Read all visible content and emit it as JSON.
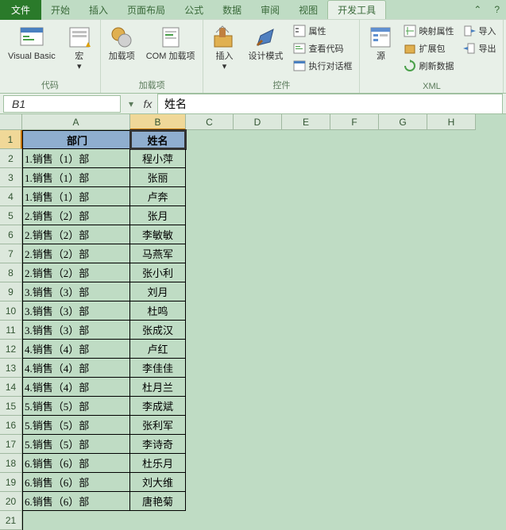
{
  "tabs": {
    "file": "文件",
    "home": "开始",
    "insert": "插入",
    "layout": "页面布局",
    "formulas": "公式",
    "data": "数据",
    "review": "审阅",
    "view": "视图",
    "developer": "开发工具"
  },
  "ribbon": {
    "vb": "Visual Basic",
    "macro": "宏",
    "group_code": "代码",
    "addins": "加载项",
    "comaddins": "COM 加载项",
    "group_addins": "加载项",
    "insert": "插入",
    "design": "设计模式",
    "properties": "属性",
    "viewcode": "查看代码",
    "rundialog": "执行对话框",
    "group_controls": "控件",
    "source": "源",
    "mapprops": "映射属性",
    "expansion": "扩展包",
    "refresh": "刷新数据",
    "import": "导入",
    "export": "导出",
    "group_xml": "XML"
  },
  "namebox": "B1",
  "formula": "姓名",
  "colheads": [
    "A",
    "B",
    "C",
    "D",
    "E",
    "F",
    "G",
    "H"
  ],
  "header": {
    "dept": "部门",
    "name": "姓名"
  },
  "rows": [
    {
      "a": "1.销售（1）部",
      "b": "程小萍"
    },
    {
      "a": "1.销售（1）部",
      "b": "张丽"
    },
    {
      "a": "1.销售（1）部",
      "b": "卢奔"
    },
    {
      "a": "2.销售（2）部",
      "b": "张月"
    },
    {
      "a": "2.销售（2）部",
      "b": "李敏敏"
    },
    {
      "a": "2.销售（2）部",
      "b": "马燕军"
    },
    {
      "a": "2.销售（2）部",
      "b": "张小利"
    },
    {
      "a": "3.销售（3）部",
      "b": "刘月"
    },
    {
      "a": "3.销售（3）部",
      "b": "杜鸣"
    },
    {
      "a": "3.销售（3）部",
      "b": "张成汉"
    },
    {
      "a": "4.销售（4）部",
      "b": "卢红"
    },
    {
      "a": "4.销售（4）部",
      "b": "李佳佳"
    },
    {
      "a": "4.销售（4）部",
      "b": "杜月兰"
    },
    {
      "a": "5.销售（5）部",
      "b": "李成斌"
    },
    {
      "a": "5.销售（5）部",
      "b": "张利军"
    },
    {
      "a": "5.销售（5）部",
      "b": "李诗奇"
    },
    {
      "a": "6.销售（6）部",
      "b": "杜乐月"
    },
    {
      "a": "6.销售（6）部",
      "b": "刘大维"
    },
    {
      "a": "6.销售（6）部",
      "b": "唐艳菊"
    }
  ]
}
